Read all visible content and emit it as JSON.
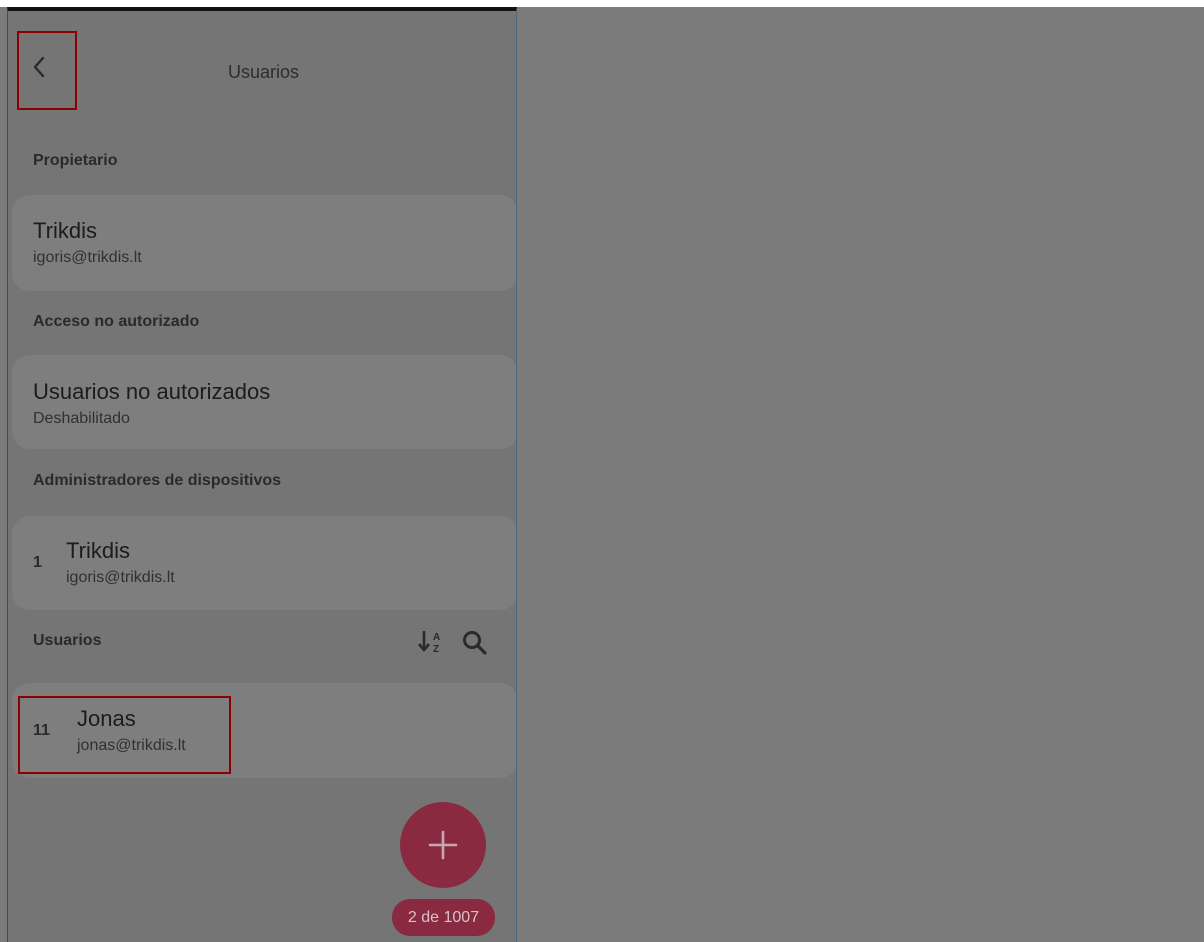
{
  "header": {
    "title": "Usuarios",
    "back_icon": "chevron-left-icon"
  },
  "sections": {
    "owner_label": "Propietario",
    "unauthorized_label": "Acceso no autorizado",
    "admins_label": "Administradores de dispositivos",
    "users_label": "Usuarios"
  },
  "owner": {
    "name": "Trikdis",
    "email": "igoris@trikdis.lt"
  },
  "unauthorized": {
    "title": "Usuarios no autorizados",
    "status": "Deshabilitado"
  },
  "admins": [
    {
      "number": "1",
      "name": "Trikdis",
      "email": "igoris@trikdis.lt"
    }
  ],
  "users": [
    {
      "number": "11",
      "name": "Jonas",
      "email": "jonas@trikdis.lt"
    }
  ],
  "users_toolbar": {
    "sort_icon": "sort-alpha-icon",
    "search_icon": "search-icon"
  },
  "fab": {
    "icon": "plus-icon",
    "counter": "2 de 1007"
  },
  "colors": {
    "overlay": "#7b7b7b",
    "accent": "#8a2a41",
    "highlight": "#8b0000"
  }
}
